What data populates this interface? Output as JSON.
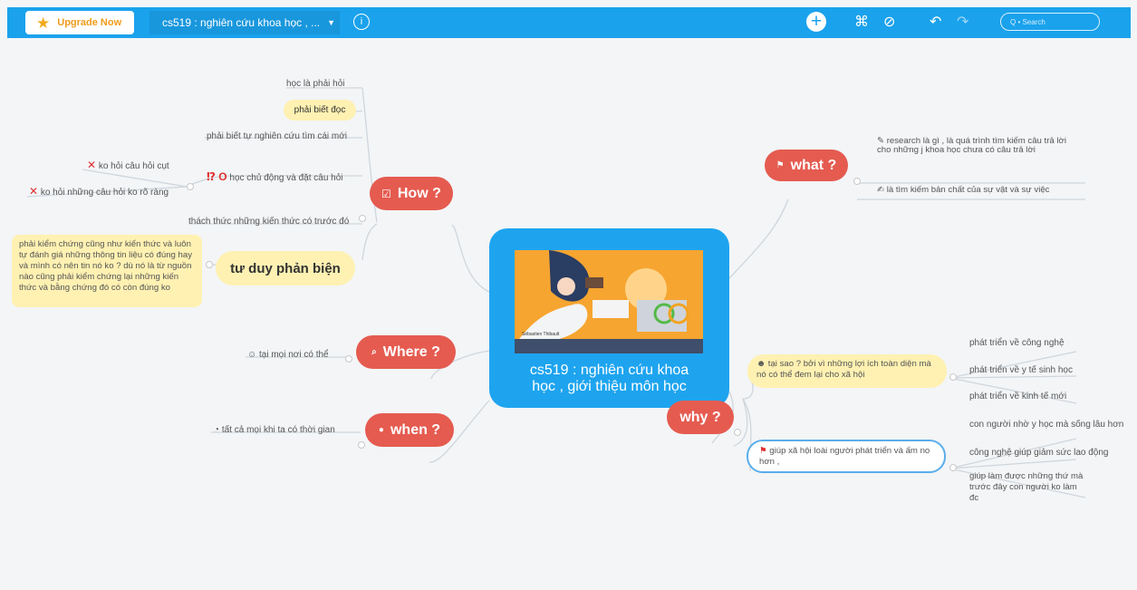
{
  "topbar": {
    "upgrade_label": "Upgrade Now",
    "map_title": "cs519 : nghiên cứu khoa học , ...",
    "search_placeholder": "Q • Search"
  },
  "central": {
    "image_credit": "Sébastien Thibault",
    "title_line1": "cs519 : nghiên cứu khoa",
    "title_line2": "học , giới thiệu môn học"
  },
  "how": {
    "label": "How ?",
    "items": [
      "học là phải hỏi",
      "phải biết đọc",
      "phải biết tự nghiên cứu tìm cái mới",
      "học chủ động và đặt câu hỏi",
      "thách thức những kiến thức có trước đó"
    ],
    "subitems": [
      "ko hỏi câu hỏi cụt",
      "ko hỏi những câu hỏi ko rõ ràng"
    ],
    "critical_label": "tư duy phản biện",
    "critical_note": "phải kiểm chứng cũng như kiến thức và luôn tự đánh giá những thông tin liệu có đúng hay và mình có nên tin nó ko ? dù nó là từ nguồn nào cũng phải kiểm chứng lại những kiến thức và bằng chứng đó có còn đúng ko"
  },
  "where": {
    "label": "Where ?",
    "item": "tại mọi nơi có thể"
  },
  "when": {
    "label": "when ?",
    "item": "tất cả mọi khi ta có thời gian"
  },
  "what": {
    "label": "what ?",
    "items": [
      "research là gì , là quá trình tìm kiếm câu trả lời cho những j khoa học chưa có câu trả lời",
      "là tìm kiếm bản chất của sự vật và sự việc"
    ]
  },
  "why": {
    "label": "why ?",
    "reason1": "tại sao ? bởi vì những lợi ích toàn diện mà nó có thể đem lại cho xã hội",
    "reason1_items": [
      "phát triển về công nghệ",
      "phát triển về y tế sinh học",
      "phát triển về kinh tế mới"
    ],
    "reason2": "giúp xã hội loài người phát triển và ấm no hơn ,",
    "reason2_items": [
      "con người nhờ y học mà sống lâu hơn",
      "công nghệ giúp giảm sức lao động",
      "giúp làm được những thứ mà trước đây con người ko làm đc"
    ]
  },
  "colors": {
    "toolbar": "#1aa2ec",
    "topic": "#e55b50",
    "note": "#fff1b2",
    "central": "#1ea4ef"
  }
}
